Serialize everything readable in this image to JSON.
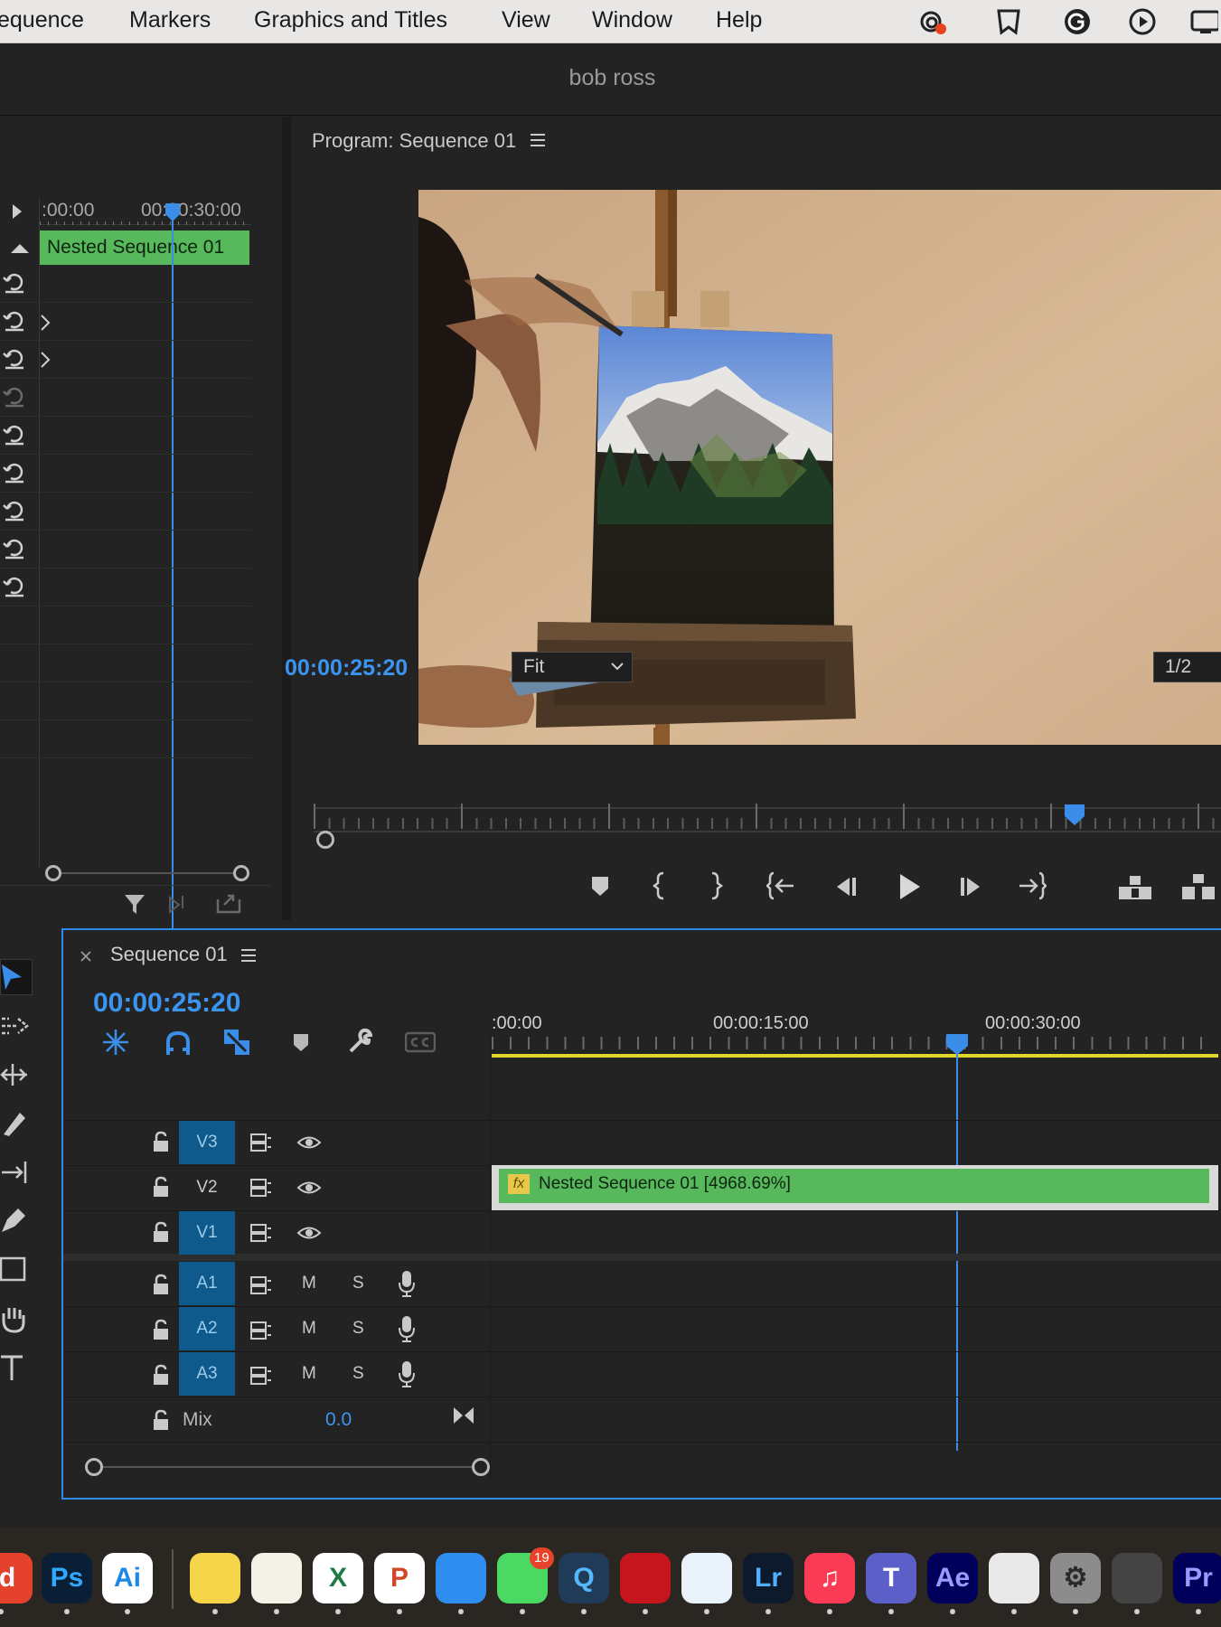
{
  "menubar": {
    "items": [
      "equence",
      "Markers",
      "Graphics and Titles",
      "View",
      "Window",
      "Help"
    ]
  },
  "app": {
    "title": "bob ross"
  },
  "source": {
    "timecode_start": ":00:00",
    "timecode_end": "00:00:30:00",
    "clip_label": "Nested Sequence 01"
  },
  "program": {
    "title": "Program: Sequence 01",
    "timecode": "00:00:25:20",
    "fit": "Fit",
    "resolution": "1/2"
  },
  "timeline": {
    "title": "Sequence 01",
    "timecode": "00:00:25:20",
    "ruler": [
      ":00:00",
      "00:00:15:00",
      "00:00:30:00"
    ],
    "clip_label": "Nested Sequence 01 [4968.69%]",
    "fx": "fx",
    "video_tracks": [
      "V3",
      "V2",
      "V1"
    ],
    "audio_tracks": [
      "A1",
      "A2",
      "A3"
    ],
    "mute_label": "M",
    "solo_label": "S",
    "mix_label": "Mix",
    "mix_value": "0.0"
  },
  "dock": {
    "apps": [
      {
        "label": "d",
        "color": "#e4422c",
        "text": "#ffffff"
      },
      {
        "label": "Ps",
        "color": "#0a1f35",
        "text": "#31a8ff"
      },
      {
        "label": "Ai",
        "color": "#ffffff",
        "text": "#1d88e5"
      },
      {
        "label": "",
        "color": "#f6d44a",
        "text": "#000000"
      },
      {
        "label": "",
        "color": "#f4f1e6",
        "text": "#000000"
      },
      {
        "label": "X",
        "color": "#ffffff",
        "text": "#1f7b45"
      },
      {
        "label": "P",
        "color": "#ffffff",
        "text": "#d24726"
      },
      {
        "label": "",
        "color": "#2f8df0",
        "text": "#ffffff"
      },
      {
        "label": "",
        "color": "#4bd964",
        "text": "#ffffff"
      },
      {
        "label": "Q",
        "color": "#1f3b57",
        "text": "#56b7ff"
      },
      {
        "label": "",
        "color": "#c4161c",
        "text": "#ffffff"
      },
      {
        "label": "",
        "color": "#e9f2fb",
        "text": "#2a84e3"
      },
      {
        "label": "Lr",
        "color": "#0c1a2c",
        "text": "#4fb1ff"
      },
      {
        "label": "♫",
        "color": "#fb3b55",
        "text": "#ffffff"
      },
      {
        "label": "T",
        "color": "#5b5fc7",
        "text": "#ffffff"
      },
      {
        "label": "Ae",
        "color": "#00005b",
        "text": "#9999ff"
      },
      {
        "label": "",
        "color": "#e9e9e9",
        "text": "#333333"
      },
      {
        "label": "⚙",
        "color": "#8c8c8c",
        "text": "#2a2a2a"
      },
      {
        "label": "",
        "color": "#444444",
        "text": "#ffffff"
      },
      {
        "label": "Pr",
        "color": "#00005b",
        "text": "#9999ff"
      }
    ],
    "messages_badge": "19"
  },
  "colors": {
    "accent": "#2d8ceb",
    "clip_green": "#57b85c",
    "track_blue": "#0e5a8c",
    "playhead": "#3a8eea",
    "ruler_yellow": "#e1d72a"
  }
}
